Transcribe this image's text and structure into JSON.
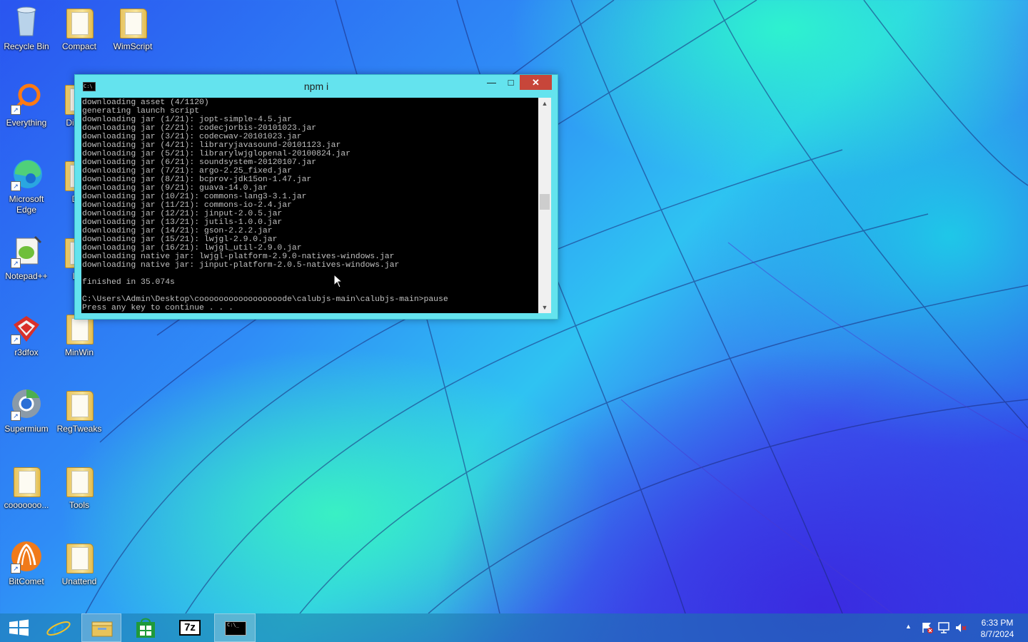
{
  "desktop": {
    "icons": [
      {
        "label": "Recycle Bin"
      },
      {
        "label": "Compact"
      },
      {
        "label": "WimScript"
      },
      {
        "label": "Everything"
      },
      {
        "label": "Dis"
      },
      {
        "label": "Microsoft Edge"
      },
      {
        "label": "D"
      },
      {
        "label": "Notepad++"
      },
      {
        "label": "L"
      },
      {
        "label": "r3dfox"
      },
      {
        "label": "MinWin"
      },
      {
        "label": "Supermium"
      },
      {
        "label": "RegTweaks"
      },
      {
        "label": "cooooooo..."
      },
      {
        "label": "Tools"
      },
      {
        "label": "BitComet"
      },
      {
        "label": "Unattend"
      }
    ]
  },
  "window": {
    "title": "npm i",
    "console_lines": [
      "downloading asset (4/1120)",
      "generating launch script",
      "downloading jar (1/21): jopt-simple-4.5.jar",
      "downloading jar (2/21): codecjorbis-20101023.jar",
      "downloading jar (3/21): codecwav-20101023.jar",
      "downloading jar (4/21): libraryjavasound-20101123.jar",
      "downloading jar (5/21): librarylwjglopenal-20100824.jar",
      "downloading jar (6/21): soundsystem-20120107.jar",
      "downloading jar (7/21): argo-2.25_fixed.jar",
      "downloading jar (8/21): bcprov-jdk15on-1.47.jar",
      "downloading jar (9/21): guava-14.0.jar",
      "downloading jar (10/21): commons-lang3-3.1.jar",
      "downloading jar (11/21): commons-io-2.4.jar",
      "downloading jar (12/21): jinput-2.0.5.jar",
      "downloading jar (13/21): jutils-1.0.0.jar",
      "downloading jar (14/21): gson-2.2.2.jar",
      "downloading jar (15/21): lwjgl-2.9.0.jar",
      "downloading jar (16/21): lwjgl_util-2.9.0.jar",
      "downloading native jar: lwjgl-platform-2.9.0-natives-windows.jar",
      "downloading native jar: jinput-platform-2.0.5-natives-windows.jar",
      "",
      "finished in 35.074s",
      "",
      "C:\\Users\\Admin\\Desktop\\cooooooooooooooooode\\calubjs-main\\calubjs-main>pause",
      "Press any key to continue . . ."
    ],
    "scroll_position": 0.48
  },
  "taskbar": {
    "items": [
      {
        "icon": "windows-start-icon"
      },
      {
        "icon": "internet-explorer-icon"
      },
      {
        "icon": "file-explorer-icon"
      },
      {
        "icon": "store-icon"
      },
      {
        "icon": "7zip-icon",
        "label": "7z"
      },
      {
        "icon": "command-prompt-icon"
      }
    ],
    "clock": {
      "time": "6:33 PM",
      "date": "8/7/2024"
    }
  },
  "colors": {
    "title_bar": "#64e3ee",
    "close_button": "#c7463a",
    "console_bg": "#000000",
    "console_text": "#c0c0c0"
  }
}
